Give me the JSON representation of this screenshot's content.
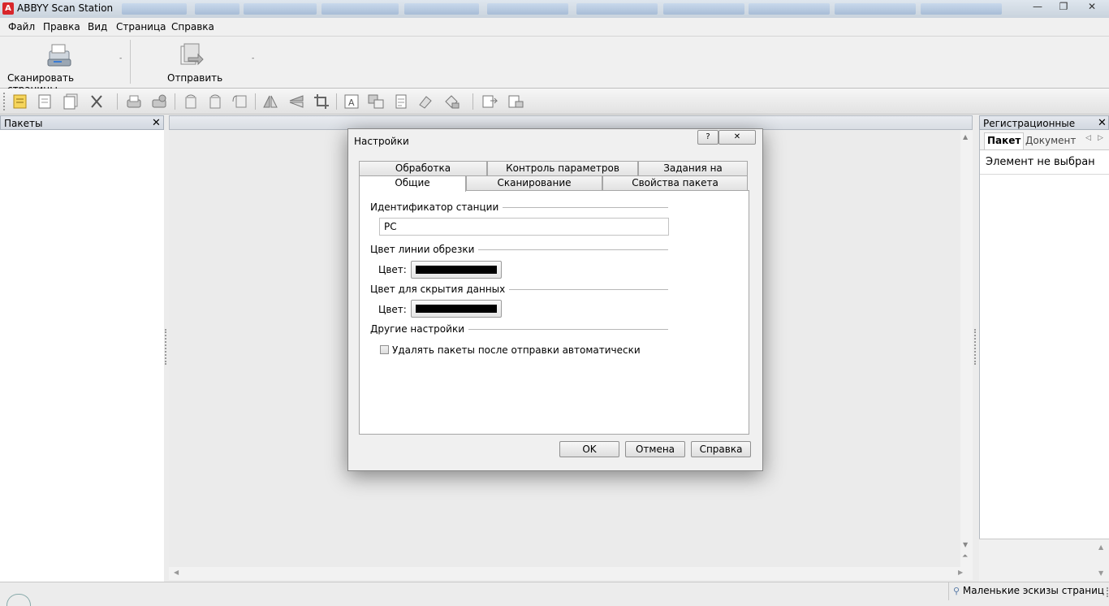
{
  "window": {
    "title": "ABBYY Scan Station",
    "logo_text": "A",
    "minimize": "—",
    "maximize": "❐",
    "close": "✕"
  },
  "menu": [
    "Файл",
    "Правка",
    "Вид",
    "Страница",
    "Справка"
  ],
  "ribbon": {
    "scan_label": "Сканировать страницы",
    "send_label": "Отправить",
    "arrow": "-"
  },
  "left_panel": {
    "title": "Пакеты",
    "close": "✕"
  },
  "right_panel": {
    "title": "Регистрационные пара...",
    "close": "✕",
    "tabs": [
      "Пакет",
      "Документ"
    ],
    "message": "Элемент не выбран"
  },
  "dialog": {
    "title": "Настройки",
    "help_btn": "?",
    "close_btn": "✕",
    "tabs_row1": [
      "Обработка изображений",
      "Контроль параметров страниц",
      "Задания на отправку"
    ],
    "tabs_row2": [
      "Общие",
      "Сканирование",
      "Свойства пакета"
    ],
    "active_tab": "Общие",
    "station_id_label": "Идентификатор станции",
    "station_id_value": "PC",
    "crop_color_label": "Цвет линии обрезки",
    "color_label": "Цвет:",
    "hide_color_label": "Цвет для скрытия данных",
    "other_label": "Другие настройки",
    "auto_delete_label": "Удалять пакеты после отправки автоматически",
    "auto_delete_checked": false,
    "buttons": {
      "ok": "OK",
      "cancel": "Отмена",
      "help": "Справка"
    }
  },
  "statusbar": {
    "thumbnails": "Маленькие эскизы страниц"
  }
}
